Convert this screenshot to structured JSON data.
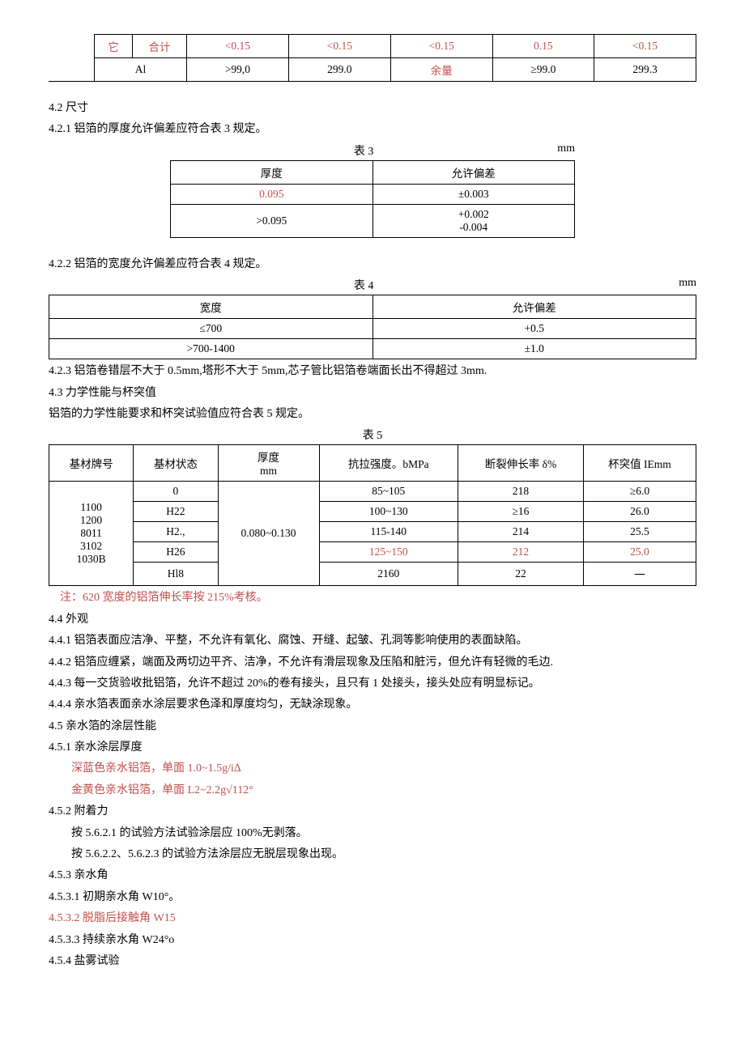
{
  "topTable": {
    "row1": {
      "c0": "它",
      "c1": "合计",
      "v1": "<0.15",
      "v2": "<0.15",
      "v3": "<0.15",
      "v4": "0.15",
      "v5": "<0.15"
    },
    "row2": {
      "c1": "Al",
      "v1": ">99,0",
      "v2": "299.0",
      "v3": "余量",
      "v4": "≥99.0",
      "v5": "299.3"
    }
  },
  "s42": {
    "title": "4.2 尺寸",
    "s421": "4.2.1 铝箔的厚度允许偏差应符合表 3 规定。",
    "t3cap": "表 3",
    "t3unit": "mm",
    "t3h1": "厚度",
    "t3h2": "允许偏差",
    "t3r1c1": "0.095",
    "t3r1c2": "±0.003",
    "t3r2c1": ">0.095",
    "t3r2c2a": "+0.002",
    "t3r2c2b": "-0.004",
    "s422": "4.2.2 铝箔的宽度允许偏差应符合表 4 规定。",
    "t4cap": "表 4",
    "t4unit": "mm",
    "t4h1": "宽度",
    "t4h2": "允许偏差",
    "t4r1c1": "≤700",
    "t4r1c2": "+0.5",
    "t4r2c1": ">700-1400",
    "t4r2c2": "±1.0",
    "s423": "4.2.3 铝箔卷错层不大于 0.5mm,塔形不大于 5mm,芯子管比铝箔卷端面长出不得超过 3mm."
  },
  "s43": {
    "title": "4.3 力学性能与杯突值",
    "intro": "铝箔的力学性能要求和杯突试验值应符合表 5 规定。",
    "t5cap": "表 5",
    "t5h1": "基材牌号",
    "t5h2": "基材状态",
    "t5h3a": "厚度",
    "t5h3b": "mm",
    "t5h4": "抗拉强度。bMPa",
    "t5h5": "断裂伸长率 δ%",
    "t5h6": "杯突值 IEmm",
    "models": [
      "1100",
      "1200",
      "8011",
      "3102",
      "1030B"
    ],
    "thick": "0.080~0.130",
    "rows": [
      {
        "state": "0",
        "str": "85~105",
        "elong": "218",
        "cup": "≥6.0"
      },
      {
        "state": "H22",
        "str": "100~130",
        "elong": "≥16",
        "cup": "26.0"
      },
      {
        "state": "H2.,",
        "str": "115-140",
        "elong": "214",
        "cup": "25.5"
      },
      {
        "state": "H26",
        "str": "125~150",
        "elong": "212",
        "cup": "25.0",
        "red": true
      },
      {
        "state": "Hl8",
        "str": "2160",
        "elong": "22",
        "cup": "一"
      }
    ],
    "note": "注：620 宽度的铝箔伸长率按 215%考核。"
  },
  "s44": {
    "title": "4.4 外观",
    "l1": "4.4.1 铝箔表面应洁净、平整，不允许有氧化、腐蚀、开缝、起皱、孔洞等影响使用的表面缺陷。",
    "l2": "4.4.2 铝箔应缠紧，端面及两切边平齐、洁净，不允许有滑层现象及压陷和脏污，但允许有轻微的毛边.",
    "l3": "4.4.3 每一交货验收批铝箔，允许不超过 20%的卷有接头，且只有 1 处接头，接头处应有明显标记。",
    "l4": "4.4.4 亲水箔表面亲水涂层要求色泽和厚度均匀，无缺涂现象。"
  },
  "s45": {
    "title": "4.5 亲水箔的涂层性能",
    "s451": "4.5.1 亲水涂层厚度",
    "blue": "深蓝色亲水铝箔，单面 1.0~1.5g/i∆",
    "gold": "金黄色亲水铝箔，单面 L2~2.2g√112°",
    "s452": "4.5.2 附着力",
    "adh1": "按 5.6.2.1 的试验方法试验涂层应 100%无剥落。",
    "adh2": "按 5.6.2.2、5.6.2.3 的试验方法涂层应无脱层现象出现。",
    "s453": "4.5.3 亲水角",
    "a1": "4.5.3.1 初期亲水角 W10°。",
    "a2": "4.5.3.2 脱脂后接触角 W15",
    "a3": "4.5.3.3 持续亲水角 W24°o",
    "s454": "4.5.4 盐雾试验"
  }
}
